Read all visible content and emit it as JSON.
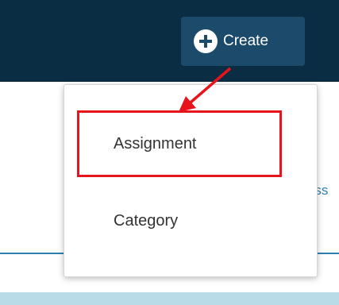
{
  "header": {
    "create_button": {
      "label": "Create",
      "icon": "plus-circle-icon"
    }
  },
  "dropdown": {
    "items": [
      {
        "label": "Assignment",
        "highlighted": true
      },
      {
        "label": "Category",
        "highlighted": false
      }
    ]
  },
  "background": {
    "partial_text": "Ass"
  },
  "colors": {
    "topbar": "#0b2d44",
    "create_button": "#1c4a6b",
    "annotation": "#e8141b",
    "link": "#2f7fae"
  }
}
